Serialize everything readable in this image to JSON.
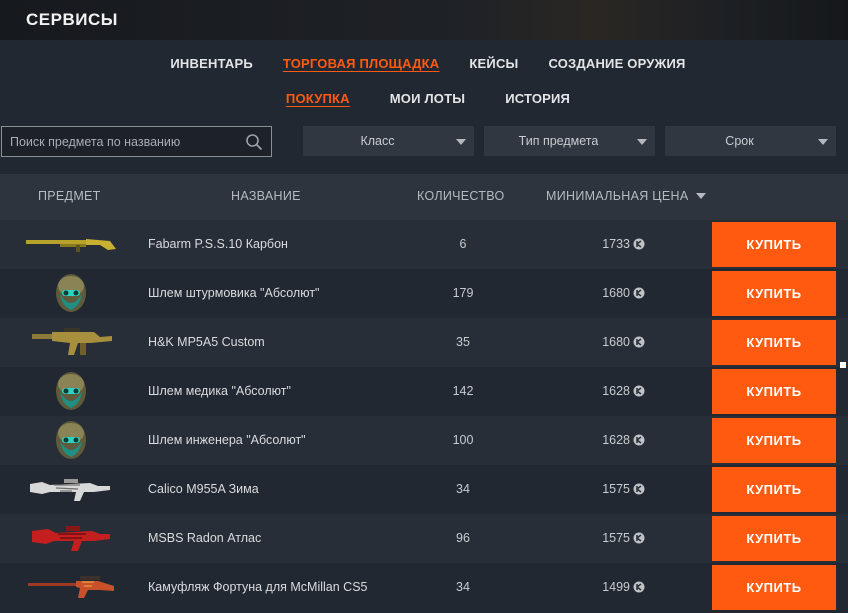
{
  "header": {
    "title": "СЕРВИСЫ"
  },
  "nav": {
    "main": [
      {
        "label": "ИНВЕНТАРЬ",
        "active": false
      },
      {
        "label": "ТОРГОВАЯ ПЛОЩАДКА",
        "active": true
      },
      {
        "label": "КЕЙСЫ",
        "active": false
      },
      {
        "label": "СОЗДАНИЕ ОРУЖИЯ",
        "active": false
      }
    ],
    "sub": [
      {
        "label": "ПОКУПКА",
        "active": true
      },
      {
        "label": "МОИ ЛОТЫ",
        "active": false
      },
      {
        "label": "ИСТОРИЯ",
        "active": false
      }
    ]
  },
  "filters": {
    "search_placeholder": "Поиск предмета по названию",
    "class_label": "Класс",
    "type_label": "Тип предмета",
    "term_label": "Срок"
  },
  "table": {
    "headers": {
      "item": "ПРЕДМЕТ",
      "name": "НАЗВАНИЕ",
      "quantity": "КОЛИЧЕСТВО",
      "min_price": "МИНИМАЛЬНАЯ ЦЕНА"
    },
    "buy_label": "КУПИТЬ",
    "rows": [
      {
        "name": "Fabarm P.S.S.10 Карбон",
        "quantity": "6",
        "price": "1733",
        "icon": "shotgun-gold-icon"
      },
      {
        "name": "Шлем штурмовика \"Абсолют\"",
        "quantity": "179",
        "price": "1680",
        "icon": "helmet-icon"
      },
      {
        "name": "H&K MP5A5 Custom",
        "quantity": "35",
        "price": "1680",
        "icon": "smg-gold-icon"
      },
      {
        "name": "Шлем медика \"Абсолют\"",
        "quantity": "142",
        "price": "1628",
        "icon": "helmet-icon"
      },
      {
        "name": "Шлем инженера \"Абсолют\"",
        "quantity": "100",
        "price": "1628",
        "icon": "helmet-icon"
      },
      {
        "name": "Calico M955A Зима",
        "quantity": "34",
        "price": "1575",
        "icon": "rifle-white-icon"
      },
      {
        "name": "MSBS Radon Атлас",
        "quantity": "96",
        "price": "1575",
        "icon": "rifle-red-icon"
      },
      {
        "name": "Камуфляж Фортуна для McMillan CS5",
        "quantity": "34",
        "price": "1499",
        "icon": "sniper-red-icon"
      }
    ]
  },
  "colors": {
    "accent": "#ff5a10",
    "background": "#222831",
    "row_alt": "#282e37",
    "header_row": "#2d343d"
  }
}
